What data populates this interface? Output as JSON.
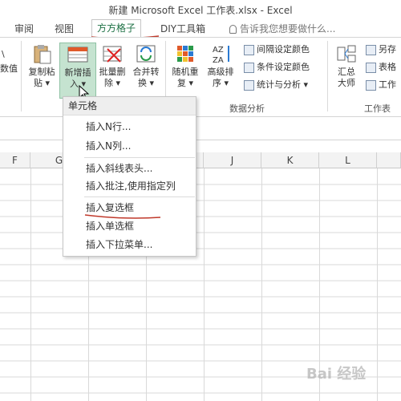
{
  "window": {
    "title": "新建 Microsoft Excel 工作表.xlsx - Excel"
  },
  "tabs": [
    {
      "label": "审阅"
    },
    {
      "label": "视图"
    },
    {
      "label": "方方格子"
    },
    {
      "label": "DIY工具箱"
    }
  ],
  "tell_me": {
    "placeholder": "告诉我您想要做什么..."
  },
  "ribbon": {
    "partial_left": [
      "\\",
      "数值"
    ],
    "buttons": [
      {
        "label1": "复制粘",
        "label2": "贴 ▾"
      },
      {
        "label1": "新增插",
        "label2": "入 ▾"
      },
      {
        "label1": "批量删",
        "label2": "除 ▾"
      },
      {
        "label1": "合并转",
        "label2": "换 ▾"
      },
      {
        "label1": "随机重",
        "label2": "复 ▾"
      },
      {
        "label1": "高级排",
        "label2": "序 ▾"
      }
    ],
    "small": [
      {
        "label": "间隔设定颜色"
      },
      {
        "label": "条件设定颜色"
      },
      {
        "label": "统计与分析 ▾"
      }
    ],
    "group_label": "数据分析",
    "right_big": {
      "label1": "汇总",
      "label2": "大师"
    },
    "right_small": [
      {
        "label": "另存"
      },
      {
        "label": "表格"
      },
      {
        "label": "工作"
      }
    ],
    "right_group_label": "工作表"
  },
  "columns": [
    "F",
    "G",
    "H",
    "I",
    "J",
    "K",
    "L"
  ],
  "menu": {
    "header": "单元格",
    "items": [
      {
        "label": "插入N行..."
      },
      {
        "label": "插入N列..."
      },
      {
        "label": "插入斜线表头..."
      },
      {
        "label": "插入批注,使用指定列"
      },
      {
        "label": "插入复选框"
      },
      {
        "label": "插入单选框"
      },
      {
        "label": "插入下拉菜单..."
      }
    ]
  },
  "colors": {
    "accent": "#1e7145",
    "underline_red": "#c0392b",
    "selected_bg": "#c5e3d0",
    "grid_line": "#d9d9d9"
  },
  "watermark": {
    "text": "Bai 经验"
  }
}
